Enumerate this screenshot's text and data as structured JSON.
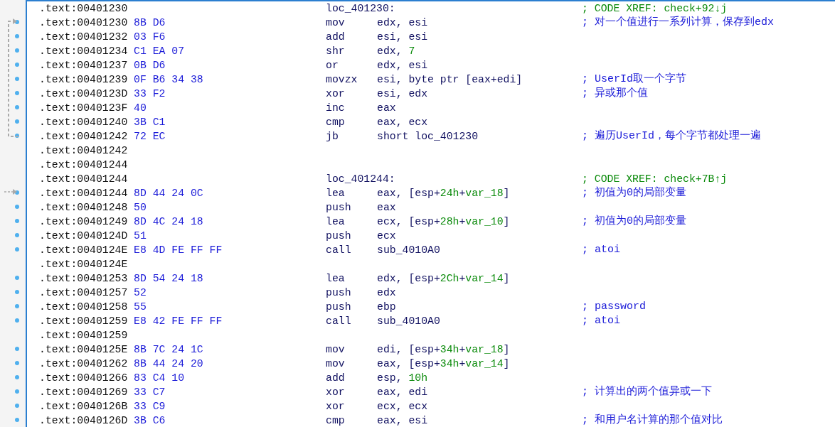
{
  "lines": [
    {
      "address": ".text:00401230",
      "dot": false,
      "label": "loc_401230:",
      "comment": {
        "kind": "xref",
        "text": "; CODE XREF: check+92↓j"
      }
    },
    {
      "address": ".text:00401230",
      "dot": true,
      "bytes": "8B D6",
      "mnemonic": "mov",
      "operands": [
        {
          "kind": "plain",
          "text": "edx, esi"
        }
      ],
      "comment": {
        "kind": "note",
        "text": "; 对一个值进行一系列计算，保存到edx"
      }
    },
    {
      "address": ".text:00401232",
      "dot": true,
      "bytes": "03 F6",
      "mnemonic": "add",
      "operands": [
        {
          "kind": "plain",
          "text": "esi, esi"
        }
      ]
    },
    {
      "address": ".text:00401234",
      "dot": true,
      "bytes": "C1 EA 07",
      "mnemonic": "shr",
      "operands": [
        {
          "kind": "plain",
          "text": "edx, "
        },
        {
          "kind": "number",
          "text": "7"
        }
      ]
    },
    {
      "address": ".text:00401237",
      "dot": true,
      "bytes": "0B D6",
      "mnemonic": "or",
      "operands": [
        {
          "kind": "plain",
          "text": "edx, esi"
        }
      ]
    },
    {
      "address": ".text:00401239",
      "dot": true,
      "bytes": "0F B6 34 38",
      "mnemonic": "movzx",
      "operands": [
        {
          "kind": "plain",
          "text": "esi, byte ptr [eax+edi]"
        }
      ],
      "comment": {
        "kind": "note",
        "text": "; UserId取一个字节"
      }
    },
    {
      "address": ".text:0040123D",
      "dot": true,
      "bytes": "33 F2",
      "mnemonic": "xor",
      "operands": [
        {
          "kind": "plain",
          "text": "esi, edx"
        }
      ],
      "comment": {
        "kind": "note",
        "text": "; 异或那个值"
      }
    },
    {
      "address": ".text:0040123F",
      "dot": true,
      "bytes": "40",
      "mnemonic": "inc",
      "operands": [
        {
          "kind": "plain",
          "text": "eax"
        }
      ]
    },
    {
      "address": ".text:00401240",
      "dot": true,
      "bytes": "3B C1",
      "mnemonic": "cmp",
      "operands": [
        {
          "kind": "plain",
          "text": "eax, ecx"
        }
      ]
    },
    {
      "address": ".text:00401242",
      "dot": true,
      "bytes": "72 EC",
      "mnemonic": "jb",
      "operands": [
        {
          "kind": "plain",
          "text": "short loc_401230"
        }
      ],
      "comment": {
        "kind": "note",
        "text": "; 遍历UserId，每个字节都处理一遍"
      }
    },
    {
      "address": ".text:00401242",
      "dot": false
    },
    {
      "address": ".text:00401244",
      "dot": false
    },
    {
      "address": ".text:00401244",
      "dot": false,
      "label": "loc_401244:",
      "comment": {
        "kind": "xref",
        "text": "; CODE XREF: check+7B↑j"
      }
    },
    {
      "address": ".text:00401244",
      "dot": true,
      "bytes": "8D 44 24 0C",
      "mnemonic": "lea",
      "operands": [
        {
          "kind": "plain",
          "text": "eax, [esp+"
        },
        {
          "kind": "number",
          "text": "24h"
        },
        {
          "kind": "plain",
          "text": "+"
        },
        {
          "kind": "number",
          "text": "var_18"
        },
        {
          "kind": "plain",
          "text": "]"
        }
      ],
      "comment": {
        "kind": "note",
        "text": "; 初值为0的局部变量"
      }
    },
    {
      "address": ".text:00401248",
      "dot": true,
      "bytes": "50",
      "mnemonic": "push",
      "operands": [
        {
          "kind": "plain",
          "text": "eax"
        }
      ]
    },
    {
      "address": ".text:00401249",
      "dot": true,
      "bytes": "8D 4C 24 18",
      "mnemonic": "lea",
      "operands": [
        {
          "kind": "plain",
          "text": "ecx, [esp+"
        },
        {
          "kind": "number",
          "text": "28h"
        },
        {
          "kind": "plain",
          "text": "+"
        },
        {
          "kind": "number",
          "text": "var_10"
        },
        {
          "kind": "plain",
          "text": "]"
        }
      ],
      "comment": {
        "kind": "note",
        "text": "; 初值为0的局部变量"
      }
    },
    {
      "address": ".text:0040124D",
      "dot": true,
      "bytes": "51",
      "mnemonic": "push",
      "operands": [
        {
          "kind": "plain",
          "text": "ecx"
        }
      ]
    },
    {
      "address": ".text:0040124E",
      "dot": true,
      "bytes": "E8 4D FE FF FF",
      "mnemonic": "call",
      "operands": [
        {
          "kind": "plain",
          "text": "sub_4010A0"
        }
      ],
      "comment": {
        "kind": "note",
        "text": "; atoi"
      }
    },
    {
      "address": ".text:0040124E",
      "dot": false
    },
    {
      "address": ".text:00401253",
      "dot": true,
      "bytes": "8D 54 24 18",
      "mnemonic": "lea",
      "operands": [
        {
          "kind": "plain",
          "text": "edx, [esp+"
        },
        {
          "kind": "number",
          "text": "2Ch"
        },
        {
          "kind": "plain",
          "text": "+"
        },
        {
          "kind": "number",
          "text": "var_14"
        },
        {
          "kind": "plain",
          "text": "]"
        }
      ]
    },
    {
      "address": ".text:00401257",
      "dot": true,
      "bytes": "52",
      "mnemonic": "push",
      "operands": [
        {
          "kind": "plain",
          "text": "edx"
        }
      ]
    },
    {
      "address": ".text:00401258",
      "dot": true,
      "bytes": "55",
      "mnemonic": "push",
      "operands": [
        {
          "kind": "plain",
          "text": "ebp"
        }
      ],
      "comment": {
        "kind": "note",
        "text": "; password"
      }
    },
    {
      "address": ".text:00401259",
      "dot": true,
      "bytes": "E8 42 FE FF FF",
      "mnemonic": "call",
      "operands": [
        {
          "kind": "plain",
          "text": "sub_4010A0"
        }
      ],
      "comment": {
        "kind": "note",
        "text": "; atoi"
      }
    },
    {
      "address": ".text:00401259",
      "dot": false
    },
    {
      "address": ".text:0040125E",
      "dot": true,
      "bytes": "8B 7C 24 1C",
      "mnemonic": "mov",
      "operands": [
        {
          "kind": "plain",
          "text": "edi, [esp+"
        },
        {
          "kind": "number",
          "text": "34h"
        },
        {
          "kind": "plain",
          "text": "+"
        },
        {
          "kind": "number",
          "text": "var_18"
        },
        {
          "kind": "plain",
          "text": "]"
        }
      ]
    },
    {
      "address": ".text:00401262",
      "dot": true,
      "bytes": "8B 44 24 20",
      "mnemonic": "mov",
      "operands": [
        {
          "kind": "plain",
          "text": "eax, [esp+"
        },
        {
          "kind": "number",
          "text": "34h"
        },
        {
          "kind": "plain",
          "text": "+"
        },
        {
          "kind": "number",
          "text": "var_14"
        },
        {
          "kind": "plain",
          "text": "]"
        }
      ]
    },
    {
      "address": ".text:00401266",
      "dot": true,
      "bytes": "83 C4 10",
      "mnemonic": "add",
      "operands": [
        {
          "kind": "plain",
          "text": "esp, "
        },
        {
          "kind": "number",
          "text": "10h"
        }
      ]
    },
    {
      "address": ".text:00401269",
      "dot": true,
      "bytes": "33 C7",
      "mnemonic": "xor",
      "operands": [
        {
          "kind": "plain",
          "text": "eax, edi"
        }
      ],
      "comment": {
        "kind": "note",
        "text": "; 计算出的两个值异或一下"
      }
    },
    {
      "address": ".text:0040126B",
      "dot": true,
      "bytes": "33 C9",
      "mnemonic": "xor",
      "operands": [
        {
          "kind": "plain",
          "text": "ecx, ecx"
        }
      ]
    },
    {
      "address": ".text:0040126D",
      "dot": true,
      "bytes": "3B C6",
      "mnemonic": "cmp",
      "operands": [
        {
          "kind": "plain",
          "text": "eax, esi"
        }
      ],
      "comment": {
        "kind": "note",
        "text": "; 和用户名计算的那个值对比"
      }
    }
  ]
}
